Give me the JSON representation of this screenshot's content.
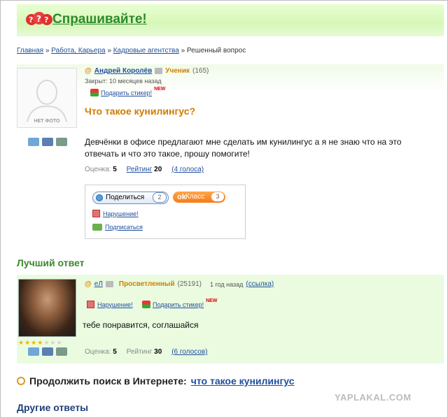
{
  "header": {
    "site_title": "Спрашивайте!",
    "logo_icon": "question-marks-icon"
  },
  "breadcrumb": {
    "items": [
      "Главная",
      "Работа, Карьера",
      "Кадровые агентства"
    ],
    "separator": "»",
    "current": "Решенный вопрос"
  },
  "question": {
    "avatar_label": "НЕТ ФОТО",
    "author": {
      "at": "@",
      "name": "Андрей Королёв",
      "rank": "Ученик",
      "score": "(165)"
    },
    "closed": "Закрыт: 10 месяцев назад",
    "gift_label": "Подарить стикер!",
    "new_badge": "NEW",
    "title": "Что такое кунилингус?",
    "text": "Девчёнки в офисе предлагают мне сделать им кунилингус а я не знаю что на это отвечать и что это такое, прошу помогите!",
    "rating": {
      "score_label": "Оценка:",
      "score": "5",
      "rating_label": "Рейтинг",
      "rating": "20",
      "votes": "(4 голоса)"
    },
    "share": {
      "share_label": "Поделиться",
      "share_count": "2",
      "class_label": "Класс",
      "class_count": "3",
      "violation": "Нарушение!",
      "subscribe": "Подписаться"
    }
  },
  "best_answer": {
    "heading": "Лучший ответ",
    "author": {
      "at": "@",
      "name": "eЛ",
      "rank": "Просветленный",
      "score": "(25191)",
      "time": "1 год назад",
      "link": "(ссылка)"
    },
    "stars": {
      "filled": 4,
      "total": 7
    },
    "violation": "Нарушение!",
    "gift_label": "Подарить стикер!",
    "new_badge": "NEW",
    "text": "тебе понравится, соглашайся",
    "rating": {
      "score_label": "Оценка:",
      "score": "5",
      "rating_label": "Рейтинг",
      "rating": "30",
      "votes": "(6 голосов)"
    }
  },
  "search": {
    "label": "Продолжить поиск в Интернете:",
    "query": "что такое кунилингус"
  },
  "other_answers": {
    "heading": "Другие ответы"
  },
  "watermark": "YAPLAKAL.COM",
  "colors": {
    "accent_green": "#3a8a2a",
    "link_blue": "#1f4f9c",
    "title_orange": "#d07b00",
    "answer_bg": "#eafbe0"
  }
}
